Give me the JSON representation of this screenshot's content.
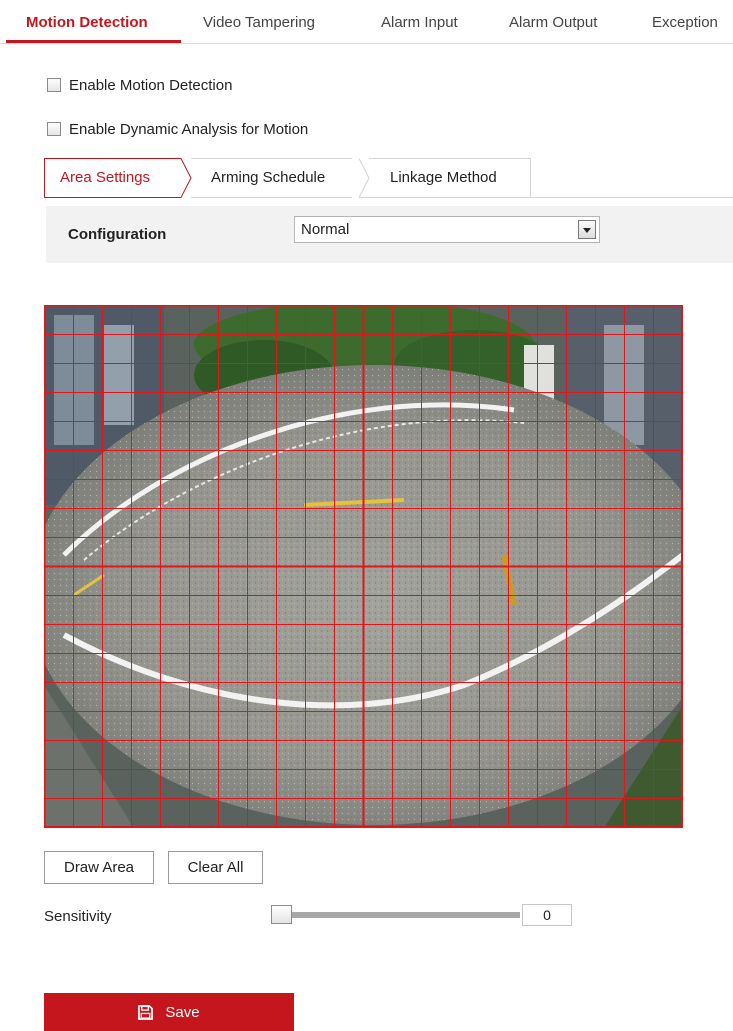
{
  "top_tabs": [
    {
      "label": "Motion Detection",
      "active": true
    },
    {
      "label": "Video Tampering",
      "active": false
    },
    {
      "label": "Alarm Input",
      "active": false
    },
    {
      "label": "Alarm Output",
      "active": false
    },
    {
      "label": "Exception",
      "active": false
    }
  ],
  "checkboxes": {
    "enable_motion": {
      "label": "Enable Motion Detection",
      "checked": false
    },
    "enable_dynamic": {
      "label": "Enable Dynamic Analysis for Motion",
      "checked": false
    }
  },
  "sub_tabs": [
    {
      "label": "Area Settings",
      "active": true
    },
    {
      "label": "Arming Schedule",
      "active": false
    },
    {
      "label": "Linkage Method",
      "active": false
    }
  ],
  "configuration": {
    "label": "Configuration",
    "value": "Normal"
  },
  "grid": {
    "columns": 22,
    "rows": 18,
    "line_color": "#e0161c"
  },
  "buttons": {
    "draw_area": "Draw Area",
    "clear_all": "Clear All",
    "save": "Save"
  },
  "sensitivity": {
    "label": "Sensitivity",
    "value": "0",
    "level": 0
  },
  "colors": {
    "accent": "#c4161c"
  }
}
